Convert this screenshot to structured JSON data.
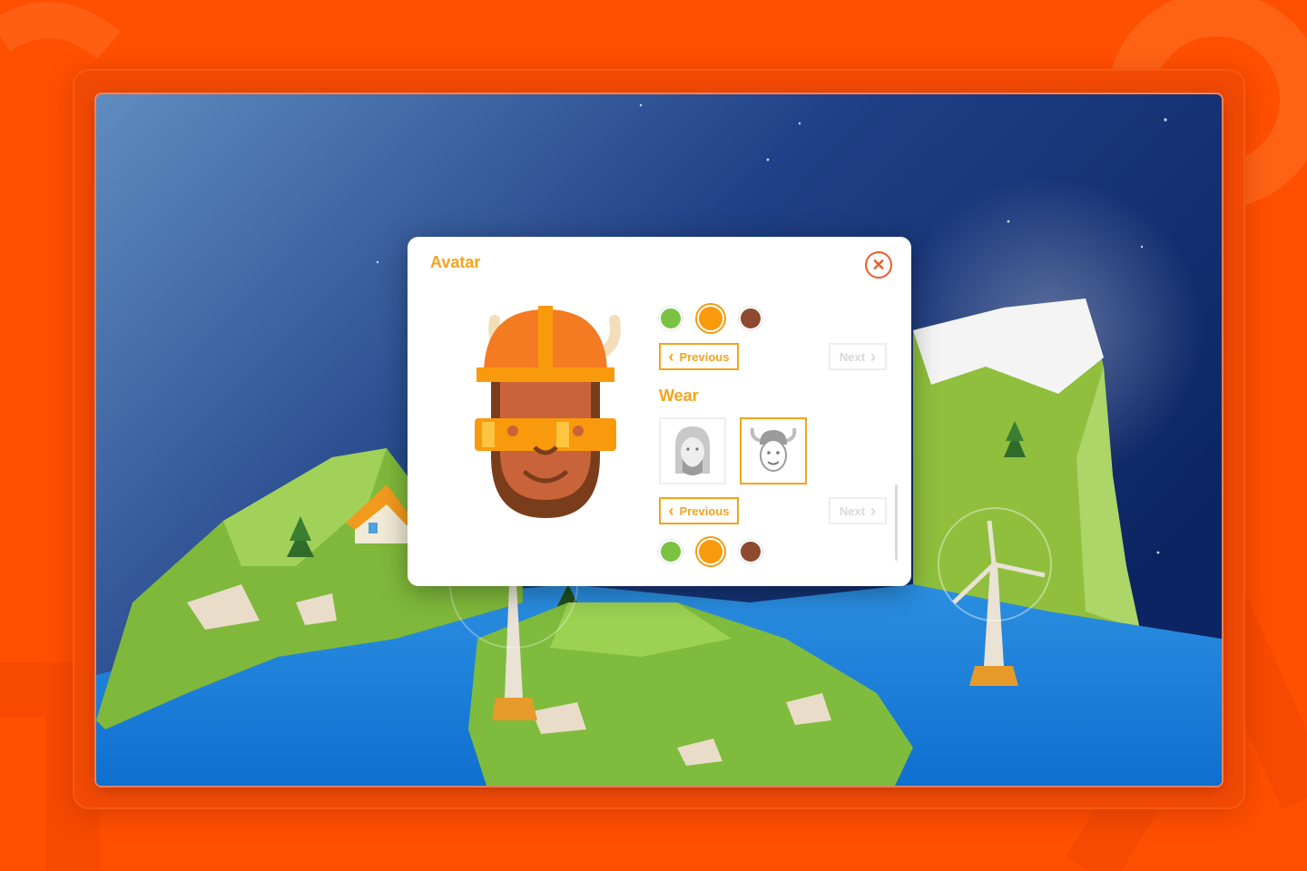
{
  "colors": {
    "brand_orange": "#ff4f00",
    "accent": "#f4a41a",
    "close_red": "#ef5a2d"
  },
  "avatar_dialog": {
    "title": "Avatar",
    "close_icon": "close-icon",
    "color_row_1": {
      "options": [
        {
          "color": "#7cc242",
          "selected": false
        },
        {
          "color": "#f99a0c",
          "selected": true
        },
        {
          "color": "#8d4a2e",
          "selected": false
        }
      ]
    },
    "pager_1": {
      "previous_label": "Previous",
      "next_label": "Next",
      "next_disabled": true
    },
    "wear": {
      "title": "Wear",
      "items": [
        {
          "icon": "long-hair-avatar-icon",
          "selected": false
        },
        {
          "icon": "viking-helmet-avatar-icon",
          "selected": true
        }
      ]
    },
    "pager_2": {
      "previous_label": "Previous",
      "next_label": "Next",
      "next_disabled": true
    },
    "color_row_2": {
      "options": [
        {
          "color": "#7cc242",
          "selected": false
        },
        {
          "color": "#f99a0c",
          "selected": true
        },
        {
          "color": "#8d4a2e",
          "selected": false
        }
      ]
    }
  }
}
